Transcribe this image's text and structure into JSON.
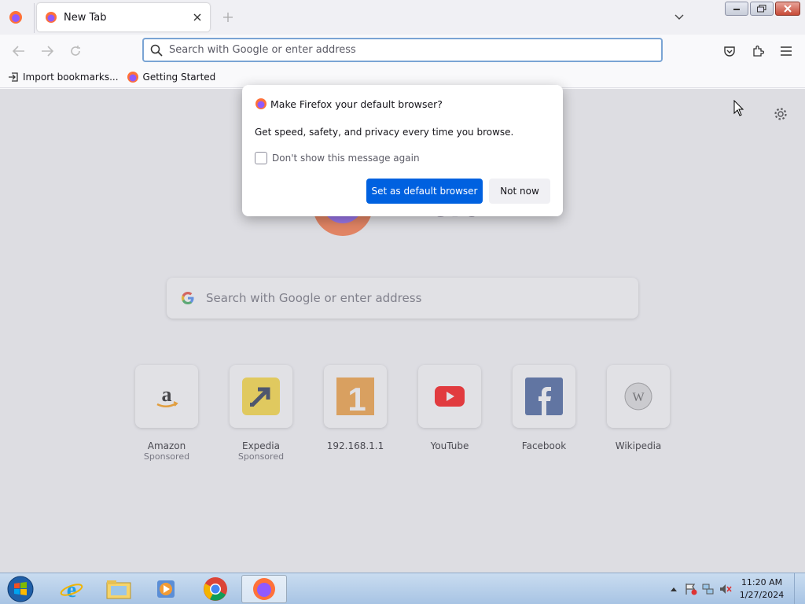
{
  "tabs": [
    {
      "label": "New Tab",
      "active": true
    }
  ],
  "urlbar": {
    "placeholder": "Search with Google or enter address"
  },
  "bookmarks": [
    {
      "label": "Import bookmarks...",
      "icon": "import-icon"
    },
    {
      "label": "Getting Started",
      "icon": "firefox-icon"
    }
  ],
  "newtab": {
    "logo_text": "Firefox",
    "search_placeholder": "Search with Google or enter address",
    "tiles": [
      {
        "label": "Amazon",
        "sub": "Sponsored",
        "icon": "amazon-icon"
      },
      {
        "label": "Expedia",
        "sub": "Sponsored",
        "icon": "expedia-icon"
      },
      {
        "label": "192.168.1.1",
        "sub": "",
        "icon": "site-1-icon"
      },
      {
        "label": "YouTube",
        "sub": "",
        "icon": "youtube-icon"
      },
      {
        "label": "Facebook",
        "sub": "",
        "icon": "facebook-icon"
      },
      {
        "label": "Wikipedia",
        "sub": "",
        "icon": "wikipedia-icon"
      }
    ]
  },
  "dialog": {
    "title": "Make Firefox your default browser?",
    "body": "Get speed, safety, and privacy every time you browse.",
    "checkbox_label": "Don't show this message again",
    "checkbox_checked": false,
    "primary_label": "Set as default browser",
    "secondary_label": "Not now"
  },
  "taskbar": {
    "clock_time": "11:20 AM",
    "clock_date": "1/27/2024",
    "apps": [
      "internet-explorer-icon",
      "file-explorer-icon",
      "media-player-icon",
      "chrome-icon",
      "firefox-icon"
    ]
  },
  "colors": {
    "accent": "#0061e0",
    "urlbar_border": "#7aa4d4"
  }
}
